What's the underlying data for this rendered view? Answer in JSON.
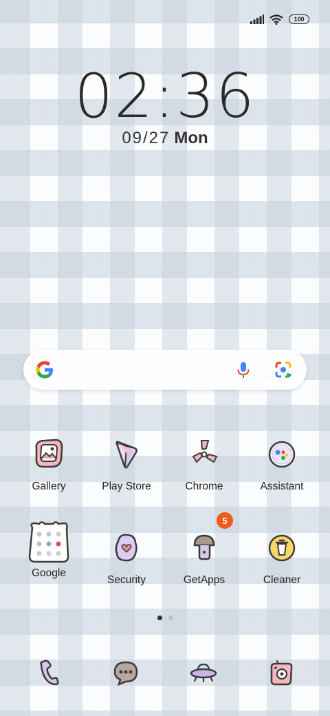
{
  "status_bar": {
    "battery_level": "100",
    "icons": [
      "signal-icon",
      "wifi-icon",
      "battery-icon"
    ]
  },
  "clock": {
    "time": "02:36"
  },
  "date": {
    "date": "09/27",
    "weekday": "Mon"
  },
  "search": {
    "icons": [
      "google-g-icon",
      "mic-icon",
      "lens-icon"
    ]
  },
  "apps": [
    {
      "label": "Gallery",
      "icon": "gallery-icon"
    },
    {
      "label": "Play Store",
      "icon": "play-store-icon"
    },
    {
      "label": "Chrome",
      "icon": "chrome-icon"
    },
    {
      "label": "Assistant",
      "icon": "assistant-icon"
    },
    {
      "label": "Google",
      "icon": "google-folder-icon"
    },
    {
      "label": "Security",
      "icon": "security-icon"
    },
    {
      "label": "GetApps",
      "icon": "getapps-icon",
      "badge": "5"
    },
    {
      "label": "Cleaner",
      "icon": "cleaner-icon"
    }
  ],
  "page_indicator": {
    "pages": 2,
    "current": 1
  },
  "dock": [
    {
      "icon": "phone-icon"
    },
    {
      "icon": "messages-icon"
    },
    {
      "icon": "browser-icon"
    },
    {
      "icon": "camera-icon"
    }
  ],
  "colors": {
    "badge": "#f05a1a",
    "outline": "#3b3b3b"
  }
}
